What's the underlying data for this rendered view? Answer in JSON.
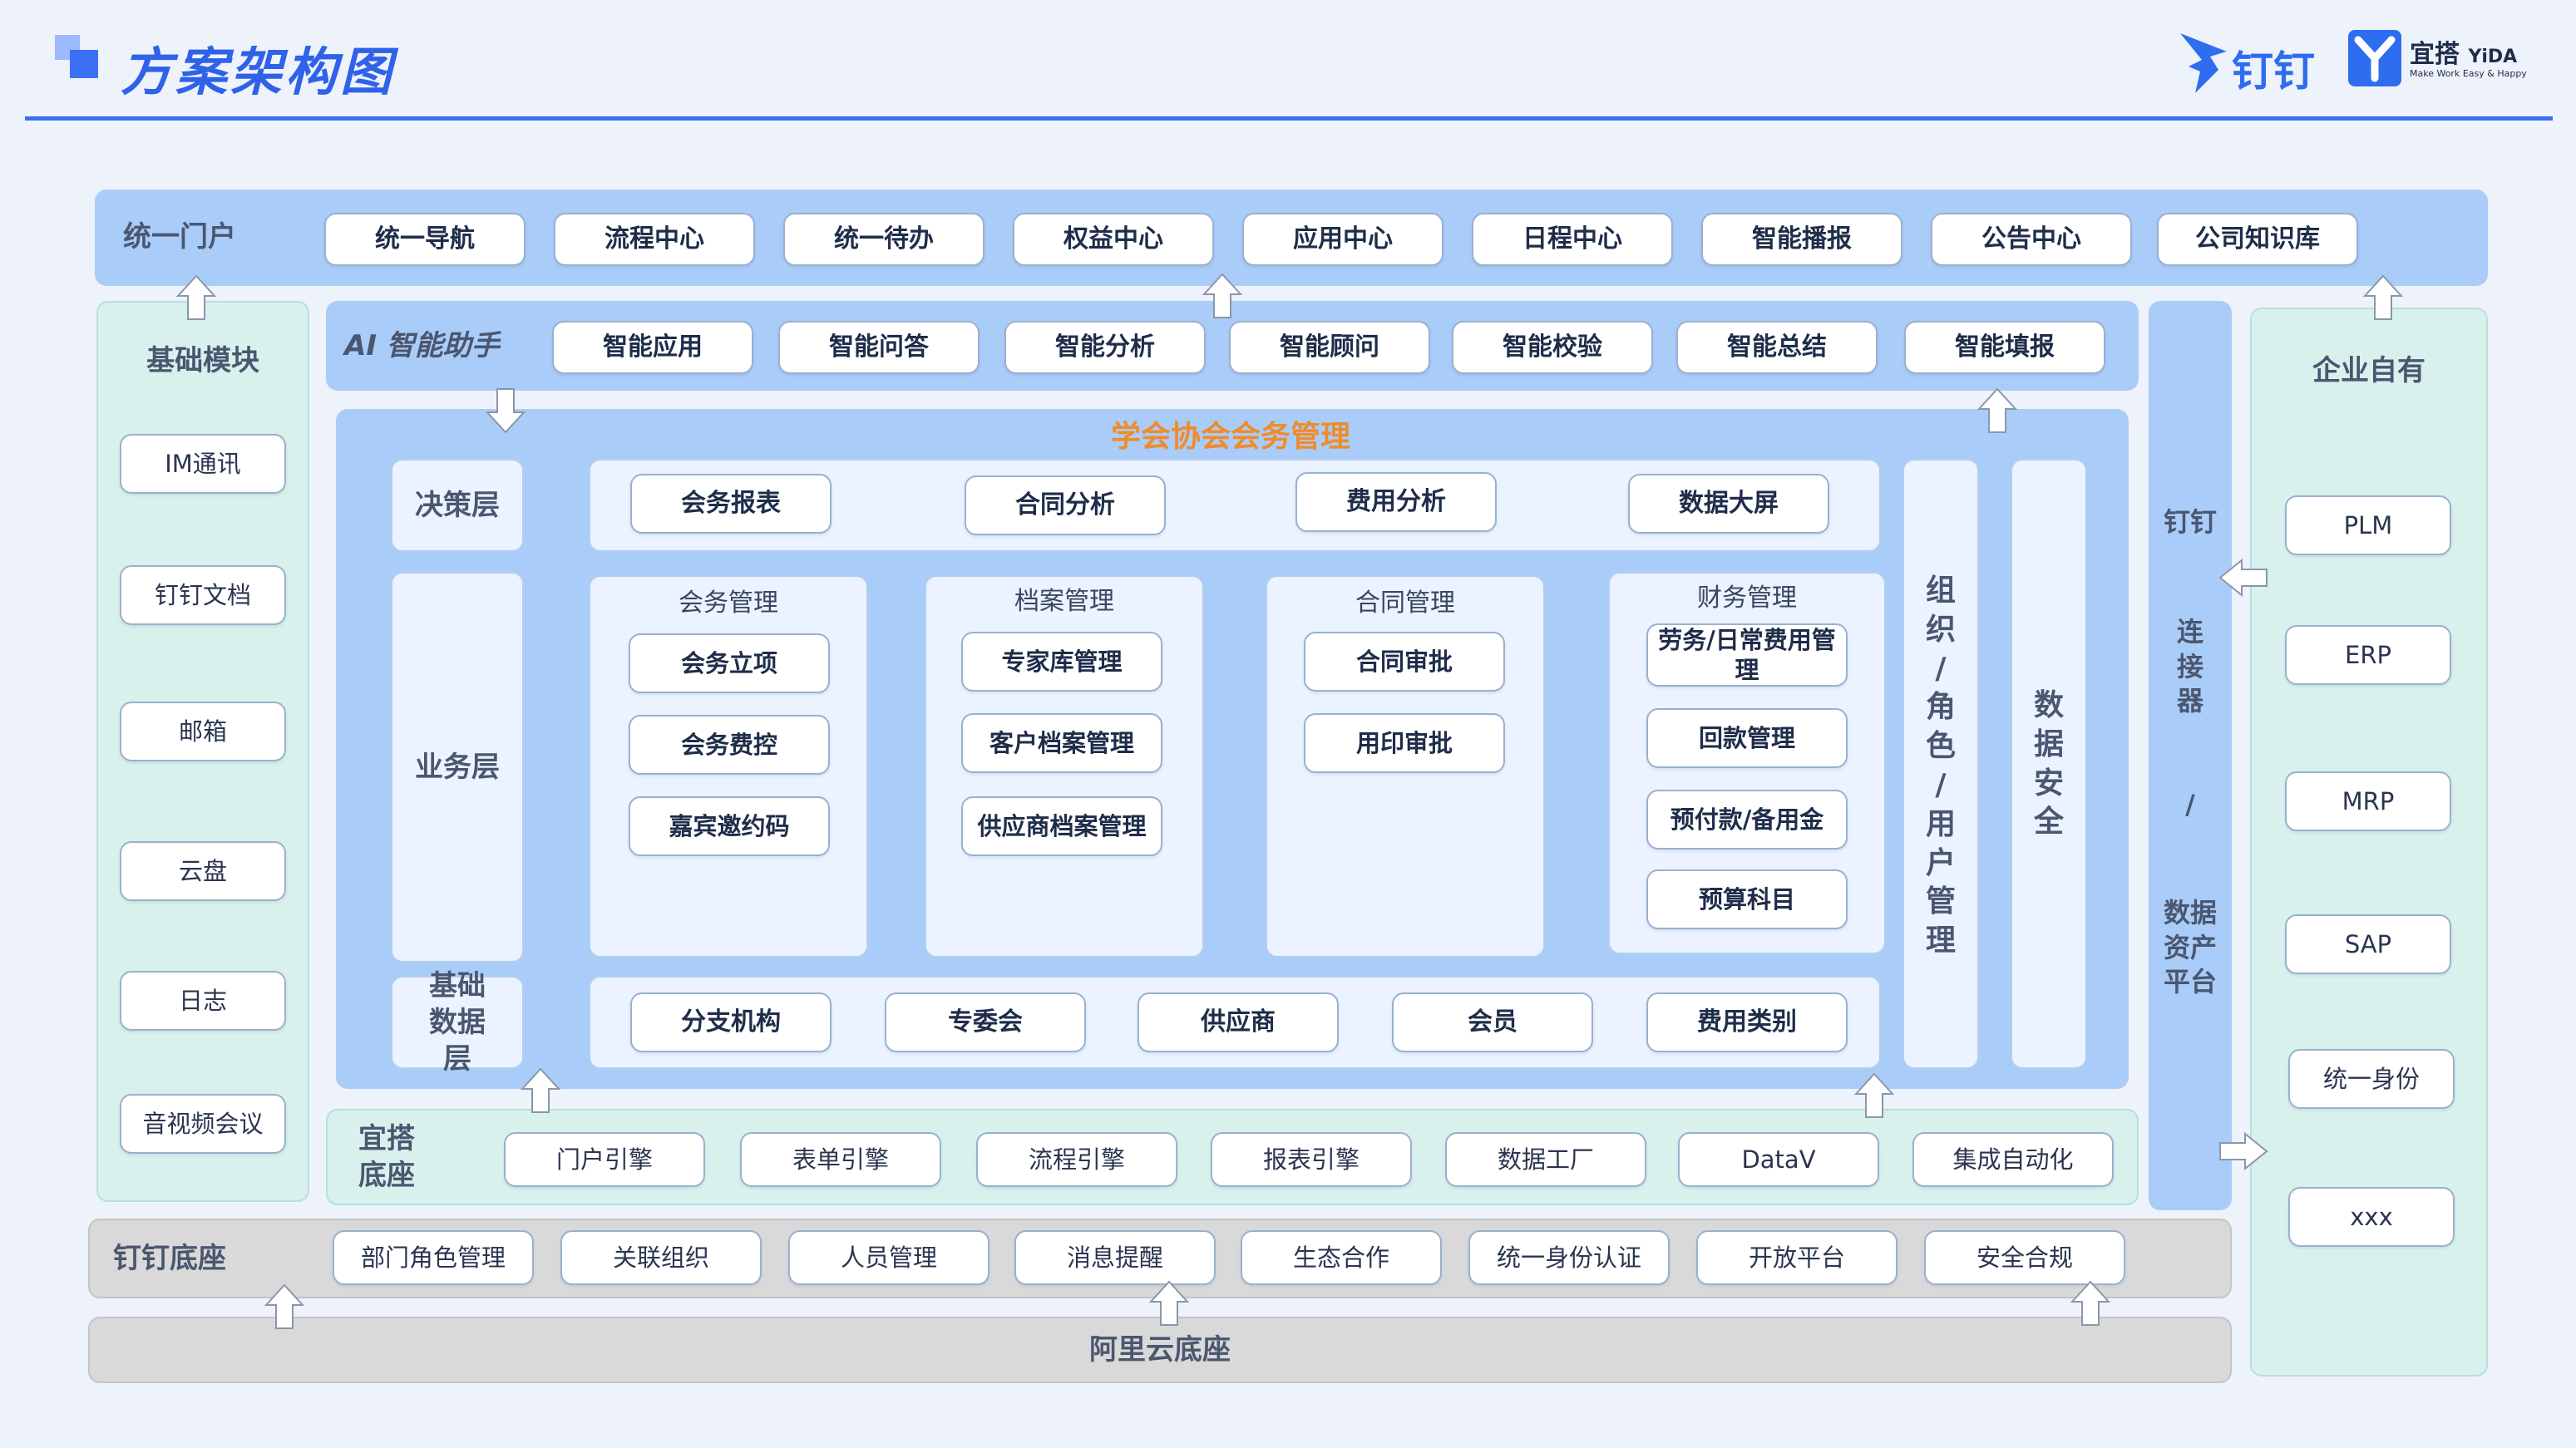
{
  "header": {
    "title": "方案架构图",
    "logo_dingtalk": "钉钉",
    "logo_yida": "宜搭",
    "logo_yida_en": "YiDA",
    "logo_yida_tagline": "Make Work Easy & Happy"
  },
  "portal": {
    "label": "统一门户",
    "items": [
      "统一导航",
      "流程中心",
      "统一待办",
      "权益中心",
      "应用中心",
      "日程中心",
      "智能播报",
      "公告中心",
      "公司知识库"
    ]
  },
  "basic_modules": {
    "label": "基础模块",
    "items": [
      "IM通讯",
      "钉钉文档",
      "邮箱",
      "云盘",
      "日志",
      "音视频会议"
    ]
  },
  "ai_assistant": {
    "label": "AI 智能助手",
    "items": [
      "智能应用",
      "智能问答",
      "智能分析",
      "智能顾问",
      "智能校验",
      "智能总结",
      "智能填报"
    ]
  },
  "core": {
    "title": "学会协会会务管理",
    "decision_layer": {
      "label": "决策层",
      "items": [
        "会务报表",
        "合同分析",
        "费用分析",
        "数据大屏"
      ]
    },
    "business_layer": {
      "label": "业务层",
      "groups": [
        {
          "title": "会务管理",
          "items": [
            "会务立项",
            "会务费控",
            "嘉宾邀约码"
          ]
        },
        {
          "title": "档案管理",
          "items": [
            "专家库管理",
            "客户档案管理",
            "供应商档案管理"
          ]
        },
        {
          "title": "合同管理",
          "items": [
            "合同审批",
            "用印审批"
          ]
        },
        {
          "title": "财务管理",
          "items": [
            "劳务/日常费用管理",
            "回款管理",
            "预付款/备用金",
            "预算科目"
          ]
        }
      ]
    },
    "base_data_layer": {
      "label": "基础数据层",
      "items": [
        "分支机构",
        "专委会",
        "供应商",
        "会员",
        "费用类别"
      ]
    },
    "org_mgmt": "组织/角色/用户管理",
    "data_security": "数据安全"
  },
  "yida_base": {
    "label": "宜搭底座",
    "items": [
      "门户引擎",
      "表单引擎",
      "流程引擎",
      "报表引擎",
      "数据工厂",
      "DataV",
      "集成自动化"
    ]
  },
  "connector": {
    "line1": "钉钉",
    "line2": "连接器",
    "line3": "/",
    "line4": "数据资产平台"
  },
  "enterprise": {
    "label": "企业自有",
    "items": [
      "PLM",
      "ERP",
      "MRP",
      "SAP",
      "统一身份",
      "xxx"
    ]
  },
  "dingtalk_base": {
    "label": "钉钉底座",
    "items": [
      "部门角色管理",
      "关联组织",
      "人员管理",
      "消息提醒",
      "生态合作",
      "统一身份认证",
      "开放平台",
      "安全合规"
    ]
  },
  "aliyun_base": {
    "label": "阿里云底座"
  },
  "colors": {
    "accent": "#3b6ff5",
    "light_blue": "#a9cdf8",
    "green_panel": "#d8f1ec",
    "orange_title": "#f08b2c"
  }
}
